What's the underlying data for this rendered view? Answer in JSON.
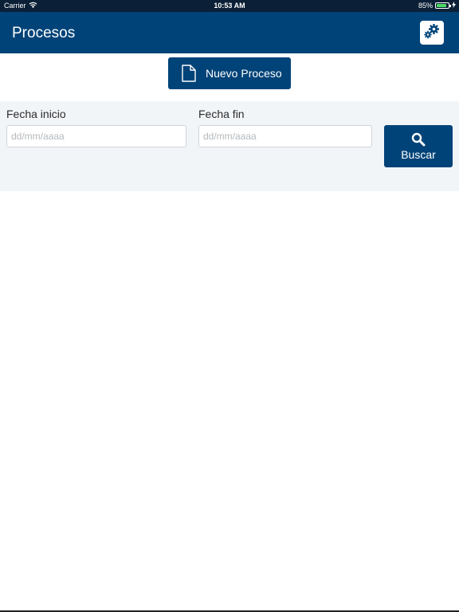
{
  "status_bar": {
    "carrier": "Carrier",
    "time": "10:53 AM",
    "battery_percent": "85%",
    "battery_level": 0.85,
    "icons": [
      "wifi-icon",
      "battery-icon",
      "charging-icon"
    ]
  },
  "header": {
    "title": "Procesos",
    "settings_icon": "gears-icon"
  },
  "toolbar": {
    "new_process_label": "Nuevo Proceso",
    "new_process_icon": "document-icon"
  },
  "filters": {
    "start_label": "Fecha inicio",
    "start_placeholder": "dd/mm/aaaa",
    "start_value": "",
    "end_label": "Fecha fin",
    "end_placeholder": "dd/mm/aaaa",
    "end_value": "",
    "search_label": "Buscar",
    "search_icon": "search-icon"
  },
  "colors": {
    "primary": "#004378",
    "status_bar": "#0b2036",
    "panel_bg": "#f2f5f8",
    "battery": "#4cd964"
  }
}
